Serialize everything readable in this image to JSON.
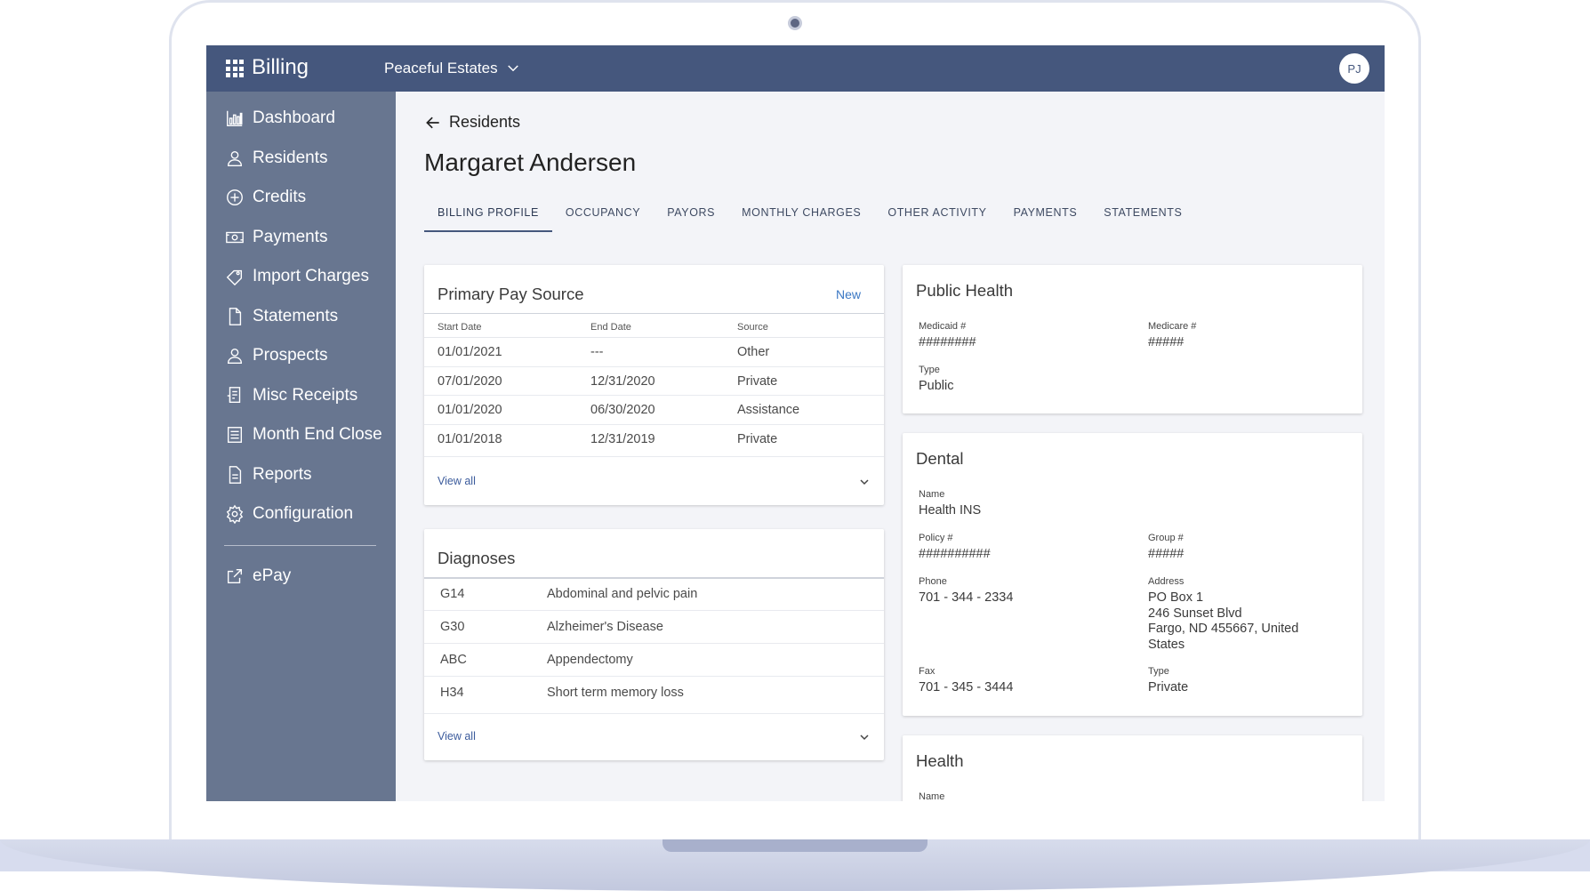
{
  "app": {
    "title": "Billing",
    "facility": "Peaceful Estates",
    "user_initials": "PJ"
  },
  "sidebar": {
    "items": [
      {
        "label": "Dashboard",
        "icon": "bar-chart-icon"
      },
      {
        "label": "Residents",
        "icon": "person-icon"
      },
      {
        "label": "Credits",
        "icon": "plus-circle-icon"
      },
      {
        "label": "Payments",
        "icon": "cash-icon"
      },
      {
        "label": "Import Charges",
        "icon": "tag-icon"
      },
      {
        "label": "Statements",
        "icon": "document-icon"
      },
      {
        "label": "Prospects",
        "icon": "person-icon"
      },
      {
        "label": "Misc Receipts",
        "icon": "receipt-icon"
      },
      {
        "label": "Month End Close",
        "icon": "calendar-list-icon"
      },
      {
        "label": "Reports",
        "icon": "report-icon"
      },
      {
        "label": "Configuration",
        "icon": "gear-icon"
      }
    ],
    "epay": {
      "label": "ePay",
      "icon": "external-link-icon"
    }
  },
  "main": {
    "back_label": "Residents",
    "title": "Margaret Andersen",
    "tabs": [
      "BILLING PROFILE",
      "OCCUPANCY",
      "PAYORS",
      "MONTHLY CHARGES",
      "OTHER ACTIVITY",
      "PAYMENTS",
      "STATEMENTS"
    ],
    "active_tab": "BILLING PROFILE"
  },
  "primary_pay_source": {
    "title": "Primary Pay Source",
    "new_label": "New",
    "columns": [
      "Start Date",
      "End Date",
      "Source"
    ],
    "rows": [
      [
        "01/01/2021",
        "---",
        "Other"
      ],
      [
        "07/01/2020",
        "12/31/2020",
        "Private"
      ],
      [
        "01/01/2020",
        "06/30/2020",
        "Assistance"
      ],
      [
        "01/01/2018",
        "12/31/2019",
        "Private"
      ]
    ],
    "view_all": "View all"
  },
  "diagnoses": {
    "title": "Diagnoses",
    "rows": [
      [
        "G14",
        "Abdominal and pelvic pain"
      ],
      [
        "G30",
        "Alzheimer's Disease"
      ],
      [
        "ABC",
        "Appendectomy"
      ],
      [
        "H34",
        "Short term memory loss"
      ]
    ],
    "view_all": "View all"
  },
  "public_health": {
    "title": "Public Health",
    "medicaid_label": "Medicaid #",
    "medicaid_value": "########",
    "medicare_label": "Medicare #",
    "medicare_value": "#####",
    "type_label": "Type",
    "type_value": "Public"
  },
  "dental": {
    "title": "Dental",
    "name_label": "Name",
    "name_value": "Health INS",
    "policy_label": "Policy #",
    "policy_value": "##########",
    "group_label": "Group #",
    "group_value": "#####",
    "phone_label": "Phone",
    "phone_value": "701 - 344 - 2334",
    "address_label": "Address",
    "address_lines": [
      "PO Box 1",
      "246 Sunset Blvd",
      "Fargo, ND 455667, United",
      "States"
    ],
    "fax_label": "Fax",
    "fax_value": "701 - 345 - 3444",
    "type_label": "Type",
    "type_value": "Private"
  },
  "health": {
    "title": "Health",
    "name_label": "Name"
  }
}
